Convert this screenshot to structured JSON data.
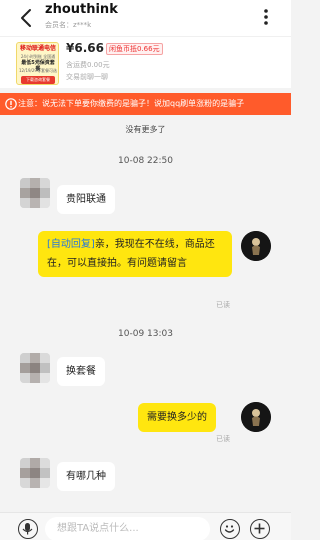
{
  "header": {
    "title": "zhouthink",
    "subtitle": "会员名：z***k"
  },
  "product": {
    "image_lines": [
      "移动联通电信",
      "24小时到账 全国通用",
      "最低5元保资套餐",
      "12/19/29等套餐可选",
      "下载咨询套餐"
    ],
    "price": "¥6.66",
    "price_tag": "闲鱼币抵0.66元",
    "shipping": "含运费0.00元",
    "trade_status": "交易前聊一聊"
  },
  "notice": {
    "text": "注意：说无法下单要你缴费的是骗子！说加qq刷单涨粉的是骗子"
  },
  "chat": {
    "no_more": "没有更多了",
    "messages": [
      {
        "type": "time",
        "text": "10-08 22:50"
      },
      {
        "type": "incoming",
        "text": "贵阳联通"
      },
      {
        "type": "outgoing",
        "auto_tag": "[自动回复]",
        "text": "亲，我现在不在线，商品还在，可以直接拍。有问题请留言",
        "status": "已读"
      },
      {
        "type": "time",
        "text": "10-09 13:03"
      },
      {
        "type": "incoming",
        "text": "换套餐"
      },
      {
        "type": "outgoing",
        "text": "需要换多少的",
        "status": "已读"
      },
      {
        "type": "incoming",
        "text": "有哪几种"
      }
    ]
  },
  "footer": {
    "placeholder": "想跟TA说点什么..."
  },
  "colors": {
    "accent_yellow": "#ffe60f",
    "notice_orange": "#ff5b2b",
    "auto_reply_blue": "#2a79d8",
    "price_red": "#e33333"
  },
  "icons": [
    "back-arrow-icon",
    "more-icon",
    "warning-icon",
    "voice-icon",
    "emoji-icon",
    "plus-icon"
  ]
}
